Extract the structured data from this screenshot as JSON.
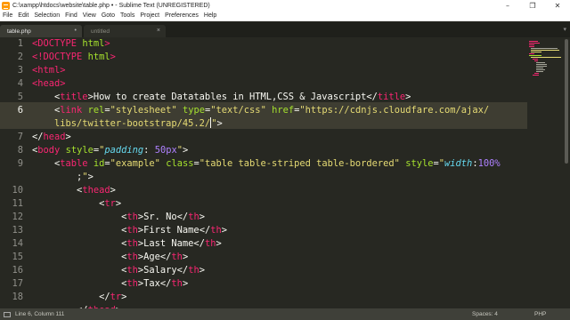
{
  "window": {
    "title": "C:\\xampp\\htdocs\\website\\table.php • - Sublime Text (UNREGISTERED)",
    "minimize": "–",
    "maximize": "❐",
    "close": "✕"
  },
  "menu": {
    "items": [
      "File",
      "Edit",
      "Selection",
      "Find",
      "View",
      "Goto",
      "Tools",
      "Project",
      "Preferences",
      "Help"
    ]
  },
  "tabs": [
    {
      "label": "table.php",
      "close": "•"
    },
    {
      "label": "untitled",
      "close": "×"
    }
  ],
  "tab_nav": "▾",
  "editor": {
    "line_numbers": [
      "1",
      "2",
      "3",
      "4",
      "5",
      "6",
      "",
      "7",
      "8",
      "9",
      "",
      "10",
      "11",
      "12",
      "13",
      "14",
      "15",
      "16",
      "17",
      "18"
    ],
    "current_line": "6"
  },
  "status": {
    "position": "Line 6, Column 111",
    "spaces": "Spaces: 4",
    "syntax": "PHP"
  },
  "colors": {
    "background": "#272822",
    "tag": "#f92672",
    "string": "#e6db74",
    "attribute": "#a6e22e",
    "number": "#ae81ff",
    "css_property": "#66d9ef",
    "text": "#f8f8f2"
  }
}
